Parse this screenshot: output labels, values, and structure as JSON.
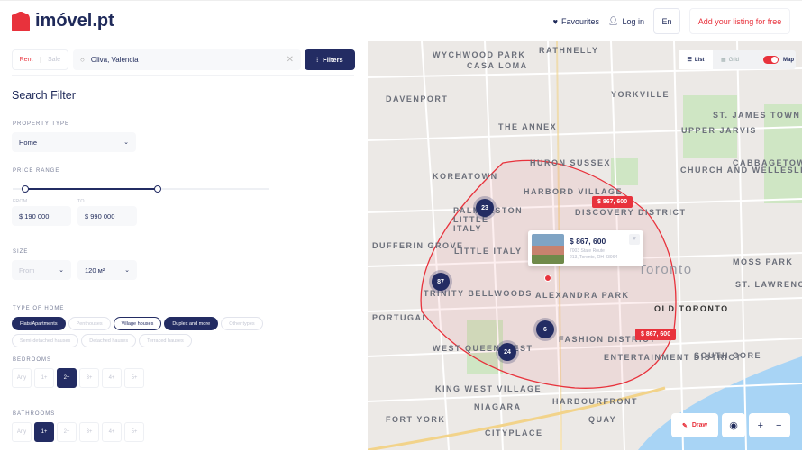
{
  "header": {
    "brand": "imóvel.pt",
    "favourites": "Favourites",
    "login": "Log in",
    "lang": "En",
    "add_listing": "Add your listing for free"
  },
  "search": {
    "rent": "Rent",
    "sale": "Sale",
    "query": "Oliva, Valencia",
    "filters": "Filters"
  },
  "filter": {
    "title": "Search Filter",
    "property_type_label": "PROPERTY TYPE",
    "property_type": "Home",
    "price_label": "PRICE RANGE",
    "from_label": "FROM",
    "to_label": "TO",
    "price_from": "$ 190 000",
    "price_to": "$ 990 000",
    "size_label": "SIZE",
    "size_from": "From",
    "size_to": "120 м²",
    "type_label": "TYPE OF HOME",
    "types": [
      {
        "label": "Flats/Apartments",
        "state": "on"
      },
      {
        "label": "Penthouses",
        "state": "off"
      },
      {
        "label": "Village houses",
        "state": "out"
      },
      {
        "label": "Duplex and more",
        "state": "on"
      },
      {
        "label": "Other types",
        "state": "off"
      }
    ],
    "types2": [
      {
        "label": "Semi-detached hauses",
        "state": "off"
      },
      {
        "label": "Detached hauses",
        "state": "off"
      },
      {
        "label": "Terraced hauses",
        "state": "off"
      }
    ],
    "bedrooms_label": "BEDROOMS",
    "bedrooms": [
      "Any",
      "1+",
      "2+",
      "3+",
      "4+",
      "5+"
    ],
    "bedrooms_selected": 2,
    "bathrooms_label": "BATHROOMS",
    "bathrooms": [
      "Any",
      "1+",
      "2+",
      "3+",
      "4+",
      "5+"
    ],
    "bathrooms_selected": 1,
    "price_range_fraction": [
      0.05,
      0.56
    ]
  },
  "map": {
    "view_list": "List",
    "view_grid": "Grid",
    "view_map": "Map",
    "labels": [
      "WYCHWOOD PARK",
      "CASA LOMA",
      "RATHNELLY",
      "DAVENPORT",
      "THE ANNEX",
      "YORKVILLE",
      "ST. JAMES TOWN",
      "UPPER JARVIS",
      "KOREATOWN",
      "HURON SUSSEX",
      "HARBORD VILLAGE",
      "DISCOVERY DISTRICT",
      "CHURCH AND WELLESLEY",
      "CABBAGETOWN",
      "PALMERSTON LITTLE ITALY",
      "LITTLE ITALY",
      "DUFFERIN GROVE",
      "TRINITY BELLWOODS",
      "ALEXANDRA PARK",
      "Toronto",
      "OLD TORONTO",
      "ST. LAWRENCE",
      "MOSS PARK",
      "PORTUGAL",
      "WEST QUEEN WEST",
      "FASHION DISTRICT",
      "ENTERTAINMENT DISTRICT",
      "SOUTH CORE",
      "KING WEST VILLAGE",
      "NIAGARA",
      "FORT YORK",
      "HARBOURFRONT",
      "CITYPLACE",
      "QUAY"
    ],
    "clusters": [
      "23",
      "87",
      "6",
      "24"
    ],
    "prices": [
      "$ 867, 600",
      "$ 867, 600"
    ],
    "card": {
      "price": "$ 867, 600",
      "address1": "7003 State Route",
      "address2": "213, Toronto, OH 43964"
    },
    "draw": "Draw",
    "zoom_in": "+",
    "zoom_out": "−"
  }
}
